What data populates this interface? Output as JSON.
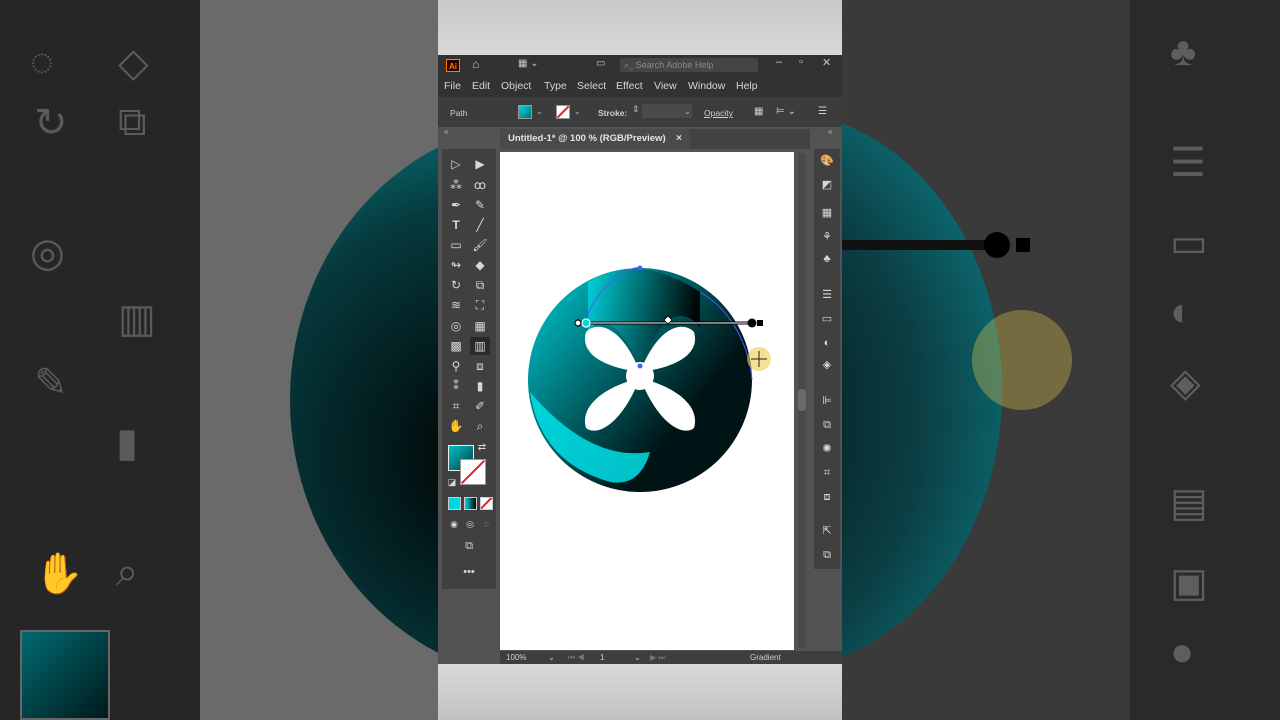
{
  "window": {
    "app_logo": "Ai",
    "search_placeholder": "Search Adobe Help"
  },
  "menu": [
    "File",
    "Edit",
    "Object",
    "Type",
    "Select",
    "Effect",
    "View",
    "Window",
    "Help"
  ],
  "control_bar": {
    "selection_type": "Path",
    "stroke_label": "Stroke:",
    "opacity_label": "Opacity"
  },
  "document": {
    "tab_title": "Untitled-1* @ 100 % (RGB/Preview)",
    "tab_close": "×"
  },
  "status_bar": {
    "zoom": "100%",
    "artboard_number": "1",
    "current_tool": "Gradient"
  },
  "colors": {
    "gradient_start": "#00d8e0",
    "gradient_end": "#000000",
    "ui_dark": "#323232",
    "ui_panel": "#404040"
  },
  "tools_icons": [
    "selection-icon",
    "direct-selection-icon",
    "magic-wand-icon",
    "lasso-icon",
    "pen-icon",
    "curvature-icon",
    "type-icon",
    "line-icon",
    "rectangle-icon",
    "paintbrush-icon",
    "shaper-icon",
    "eraser-icon",
    "rotate-icon",
    "scale-icon",
    "warp-icon",
    "free-transform-icon",
    "shape-builder-icon",
    "perspective-icon",
    "mesh-icon",
    "gradient-icon",
    "eyedropper-icon",
    "blend-icon",
    "symbol-sprayer-icon",
    "column-graph-icon",
    "artboard-icon",
    "slice-icon",
    "hand-icon",
    "zoom-icon"
  ],
  "right_panel_icons": [
    "color-icon",
    "color-guide-icon",
    "swatches-icon",
    "brushes-icon",
    "symbols-icon",
    "stroke-icon",
    "gradient-panel-icon",
    "transparency-icon",
    "layers-icon",
    "align-icon",
    "pathfinder-icon",
    "appearance-icon",
    "transform-icon",
    "artboards-icon",
    "export-icon",
    "links-icon"
  ]
}
